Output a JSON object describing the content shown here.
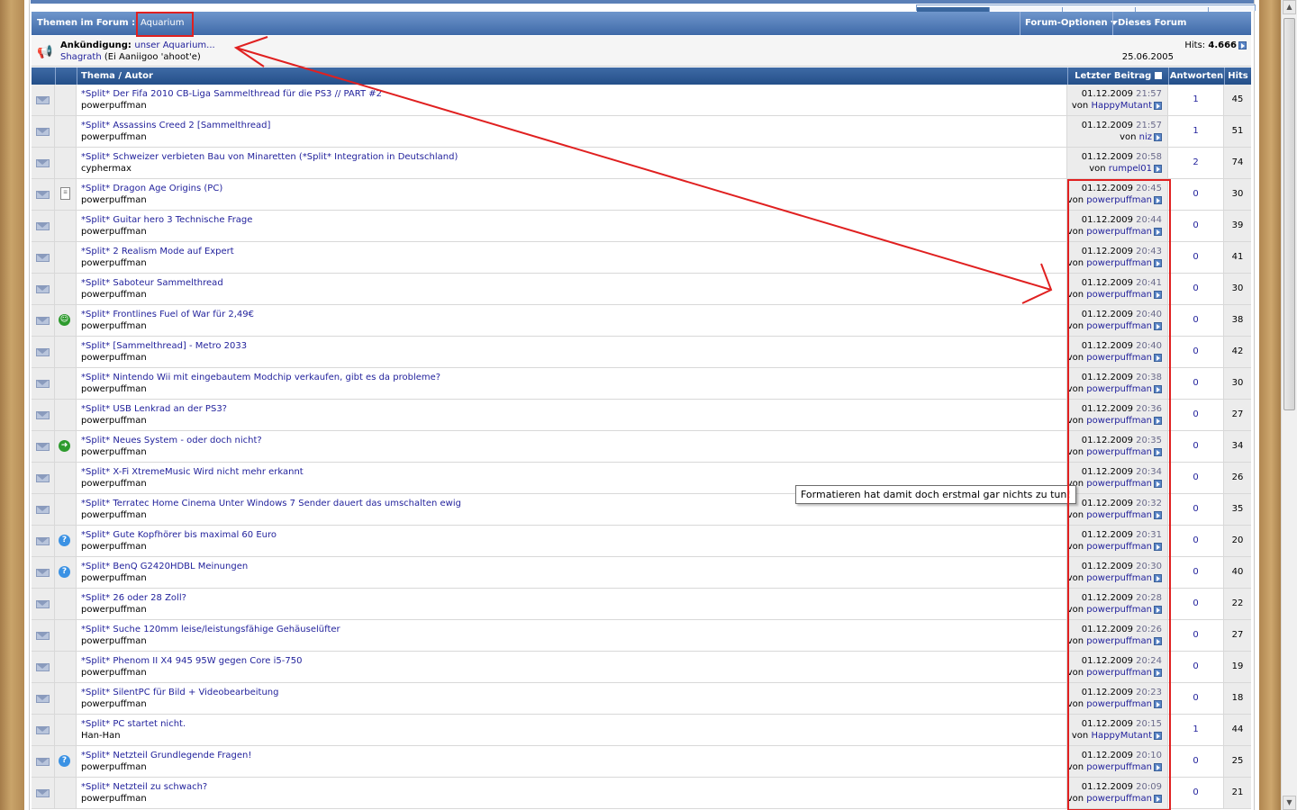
{
  "forum": {
    "header_title": "Themen im Forum :",
    "forum_name": "Aquarium",
    "options_label": "Forum-Optionen",
    "search_label": "Dieses Forum durchsuchen"
  },
  "announcement": {
    "label": "Ankündigung:",
    "title": "unser Aquarium...",
    "author": "Shagrath",
    "author_note": "(Ei Aaniigoo 'ahoot'e)",
    "hits_label": "Hits:",
    "hits_value": "4.666",
    "date": "25.06.2005"
  },
  "columns": {
    "topic": "Thema / Autor",
    "last": "Letzter Beitrag",
    "answers": "Antworten",
    "hits": "Hits"
  },
  "by_label": "von",
  "tooltip": "Formatieren hat damit doch erstmal gar nichts zu tun!",
  "annotation_color": "#e02020",
  "threads": [
    {
      "icon": "",
      "title": "*Split* Der Fifa 2010 CB-Liga Sammelthread für die PS3 // PART #2",
      "author": "powerpuffman",
      "date": "01.12.2009",
      "time": "21:57",
      "last_user": "HappyMutant",
      "answers": "1",
      "hits": "45"
    },
    {
      "icon": "",
      "title": "*Split* Assassins Creed 2 [Sammelthread]",
      "author": "powerpuffman",
      "date": "01.12.2009",
      "time": "21:57",
      "last_user": "niz",
      "answers": "1",
      "hits": "51"
    },
    {
      "icon": "",
      "title": "*Split* Schweizer verbieten Bau von Minaretten (*Split* Integration in Deutschland)",
      "author": "cyphermax",
      "date": "01.12.2009",
      "time": "20:58",
      "last_user": "rumpel01",
      "answers": "2",
      "hits": "74"
    },
    {
      "icon": "doc",
      "title": "*Split* Dragon Age Origins (PC)",
      "author": "powerpuffman",
      "date": "01.12.2009",
      "time": "20:45",
      "last_user": "powerpuffman",
      "answers": "0",
      "hits": "30"
    },
    {
      "icon": "",
      "title": "*Split* Guitar hero 3 Technische Frage",
      "author": "powerpuffman",
      "date": "01.12.2009",
      "time": "20:44",
      "last_user": "powerpuffman",
      "answers": "0",
      "hits": "39"
    },
    {
      "icon": "",
      "title": "*Split* 2 Realism Mode auf Expert",
      "author": "powerpuffman",
      "date": "01.12.2009",
      "time": "20:43",
      "last_user": "powerpuffman",
      "answers": "0",
      "hits": "41"
    },
    {
      "icon": "",
      "title": "*Split* Saboteur Sammelthread",
      "author": "powerpuffman",
      "date": "01.12.2009",
      "time": "20:41",
      "last_user": "powerpuffman",
      "answers": "0",
      "hits": "30"
    },
    {
      "icon": "grin",
      "title": "*Split* Frontlines Fuel of War für 2,49€",
      "author": "powerpuffman",
      "date": "01.12.2009",
      "time": "20:40",
      "last_user": "powerpuffman",
      "answers": "0",
      "hits": "38"
    },
    {
      "icon": "",
      "title": "*Split* [Sammelthread] - Metro 2033",
      "author": "powerpuffman",
      "date": "01.12.2009",
      "time": "20:40",
      "last_user": "powerpuffman",
      "answers": "0",
      "hits": "42"
    },
    {
      "icon": "",
      "title": "*Split* Nintendo Wii mit eingebautem Modchip verkaufen, gibt es da probleme?",
      "author": "powerpuffman",
      "date": "01.12.2009",
      "time": "20:38",
      "last_user": "powerpuffman",
      "answers": "0",
      "hits": "30"
    },
    {
      "icon": "",
      "title": "*Split* USB Lenkrad an der PS3?",
      "author": "powerpuffman",
      "date": "01.12.2009",
      "time": "20:36",
      "last_user": "powerpuffman",
      "answers": "0",
      "hits": "27"
    },
    {
      "icon": "arrow",
      "title": "*Split* Neues System - oder doch nicht?",
      "author": "powerpuffman",
      "date": "01.12.2009",
      "time": "20:35",
      "last_user": "powerpuffman",
      "answers": "0",
      "hits": "34"
    },
    {
      "icon": "",
      "title": "*Split* X-Fi XtremeMusic Wird nicht mehr erkannt",
      "author": "powerpuffman",
      "date": "01.12.2009",
      "time": "20:34",
      "last_user": "powerpuffman",
      "answers": "0",
      "hits": "26"
    },
    {
      "icon": "",
      "title": "*Split* Terratec Home Cinema Unter Windows 7 Sender dauert das umschalten ewig",
      "author": "powerpuffman",
      "date": "01.12.2009",
      "time": "20:32",
      "last_user": "powerpuffman",
      "answers": "0",
      "hits": "35"
    },
    {
      "icon": "question",
      "title": "*Split* Gute Kopfhörer bis maximal 60 Euro",
      "author": "powerpuffman",
      "date": "01.12.2009",
      "time": "20:31",
      "last_user": "powerpuffman",
      "answers": "0",
      "hits": "20"
    },
    {
      "icon": "question",
      "title": "*Split* BenQ G2420HDBL Meinungen",
      "author": "powerpuffman",
      "date": "01.12.2009",
      "time": "20:30",
      "last_user": "powerpuffman",
      "answers": "0",
      "hits": "40"
    },
    {
      "icon": "",
      "title": "*Split* 26 oder 28 Zoll?",
      "author": "powerpuffman",
      "date": "01.12.2009",
      "time": "20:28",
      "last_user": "powerpuffman",
      "answers": "0",
      "hits": "22"
    },
    {
      "icon": "",
      "title": "*Split* Suche 120mm leise/leistungsfähige Gehäuselüfter",
      "author": "powerpuffman",
      "date": "01.12.2009",
      "time": "20:26",
      "last_user": "powerpuffman",
      "answers": "0",
      "hits": "27"
    },
    {
      "icon": "",
      "title": "*Split* Phenom II X4 945 95W gegen Core i5-750",
      "author": "powerpuffman",
      "date": "01.12.2009",
      "time": "20:24",
      "last_user": "powerpuffman",
      "answers": "0",
      "hits": "19"
    },
    {
      "icon": "",
      "title": "*Split* SilentPC für Bild + Videobearbeitung",
      "author": "powerpuffman",
      "date": "01.12.2009",
      "time": "20:23",
      "last_user": "powerpuffman",
      "answers": "0",
      "hits": "18"
    },
    {
      "icon": "",
      "title": "*Split* PC startet nicht.",
      "author": "Han-Han",
      "date": "01.12.2009",
      "time": "20:15",
      "last_user": "HappyMutant",
      "answers": "1",
      "hits": "44"
    },
    {
      "icon": "question",
      "title": "*Split* Netzteil Grundlegende Fragen!",
      "author": "powerpuffman",
      "date": "01.12.2009",
      "time": "20:10",
      "last_user": "powerpuffman",
      "answers": "0",
      "hits": "25"
    },
    {
      "icon": "",
      "title": "*Split* Netzteil zu schwach?",
      "author": "powerpuffman",
      "date": "01.12.2009",
      "time": "20:09",
      "last_user": "powerpuffman",
      "answers": "0",
      "hits": "21"
    }
  ]
}
